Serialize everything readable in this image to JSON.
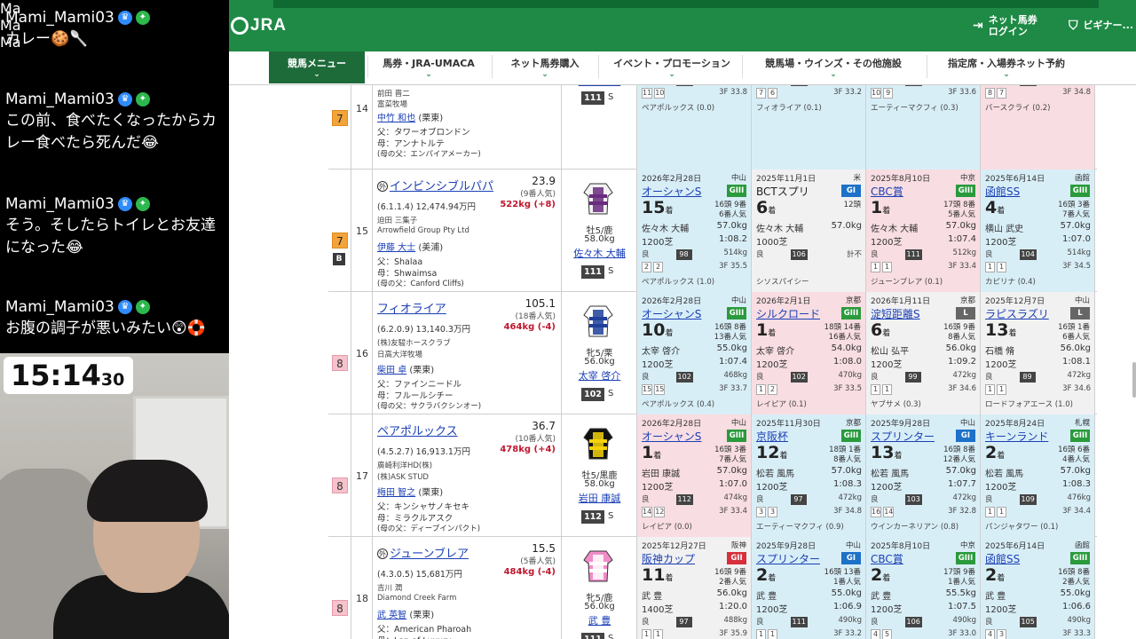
{
  "chat": {
    "messages": [
      {
        "user": "Mami_Mami03",
        "text": "カレー🍪🥄"
      },
      {
        "user": "Mami_Mami03",
        "text": "この前、食べたくなったからカレー食べたら死んだ😂"
      },
      {
        "user": "Mami_Mami03",
        "text": "そう。そしたらトイレとお友達になった😂"
      },
      {
        "user": "Mami_Mami03",
        "text": "お腹の調子が悪いみたい😲🛟"
      }
    ],
    "member_badge": "Ma"
  },
  "timer": {
    "main": "15:14",
    "sub": "30"
  },
  "header": {
    "logo": "JRA",
    "links": [
      "ネット馬券\nログイン",
      "ビギナー..."
    ],
    "nav": [
      "競馬メニュー",
      "馬券・JRA-UMACA",
      "ネット馬券購入",
      "イベント・プロモーション",
      "競馬場・ウインズ・その他施設",
      "指定席・入場券ネット予約"
    ]
  },
  "rows": [
    {
      "waku": "7",
      "num": "14",
      "partial": true,
      "owner": "前田 晋二",
      "breeder": "富菜牧場",
      "trainer": "中竹 和也",
      "region": "(栗東)",
      "sire": "父：タワーオブロンドン",
      "dam": "母：アンナトルテ",
      "damsire": "(母の父：エンパイアメーカー)",
      "sex": "牡4/鹿",
      "weight_carry": "58.0kg",
      "jockey": "丸山 元気",
      "rating": "111",
      "rating_s": "S",
      "past": [
        {
          "bg": "blue",
          "jockey": "戸崎 圭太",
          "kg": "57.0kg",
          "dist": "1200芝",
          "time": "1:07.0",
          "cond": "良",
          "score": "111",
          "bw": "510kg",
          "pos": [
            "11",
            "10"
          ],
          "last": "3F 33.8",
          "winner": "ペアポルックス (0.0)"
        },
        {
          "bg": "blue",
          "jockey": "佐々木 大輔",
          "kg": "57.0kg",
          "dist": "1200芝",
          "time": "1:08.1",
          "cond": "良",
          "score": "106",
          "bw": "516kg",
          "pos": [
            "7",
            "6"
          ],
          "last": "3F 33.2",
          "winner": "フィオライア (0.1)"
        },
        {
          "bg": "blue",
          "jockey": "鮫島 克駿",
          "kg": "56.0kg",
          "dist": "1200芝",
          "time": "1:07.7",
          "cond": "良",
          "score": "106",
          "bw": "506kg",
          "pos": [
            "10",
            "9"
          ],
          "last": "3F 33.6",
          "winner": "エーティーマクフィ (0.3)"
        },
        {
          "bg": "pink",
          "jockey": "丸山 元気",
          "kg": "56.0kg",
          "dist": "1200芝",
          "time": "1:08.3",
          "cond": "良",
          "score": "106",
          "bw": "502kg",
          "pos": [
            "8",
            "7"
          ],
          "last": "3F 34.8",
          "winner": "バースクライ (0.2)"
        }
      ]
    },
    {
      "waku": "7",
      "num": "15",
      "blinker": "B",
      "name": "インビンシブルパパ",
      "maru": "外",
      "odds": "23.9",
      "pop": "(9番人気)",
      "record": "(6.1.1.4) 12,474.94万円",
      "weight": "522kg (+8)",
      "owner": "迫田 三集子",
      "breeder": "Arrowfield Group Pty Ltd",
      "trainer": "伊藤 大士",
      "region": "(美浦)",
      "sire": "父：Shalaa",
      "dam": "母：Shwaimsa",
      "damsire": "(母の父：Canford Cliffs)",
      "sex": "牡5/鹿",
      "weight_carry": "58.0kg",
      "jockey": "佐々木 大輔",
      "rating": "111",
      "rating_s": "S",
      "silks": [
        "#f2f2f2",
        "#6a2c7e"
      ],
      "past": [
        {
          "bg": "blue",
          "date": "2026年2月28日",
          "venue": "中山",
          "race": "オーシャンS",
          "grade": "GIII",
          "place": "15",
          "fields": [
            "16頭 9番",
            "6番人気"
          ],
          "jockey": "佐々木 大輔",
          "kg": "57.0kg",
          "dist": "1200芝",
          "time": "1:08.2",
          "cond": "良",
          "score": "98",
          "bw": "514kg",
          "pos": [
            "2",
            "2"
          ],
          "last": "3F 35.5",
          "winner": "ペアポルックス (1.0)"
        },
        {
          "bg": "gray",
          "date": "2025年11月1日",
          "venue": "米",
          "race": "BCTスプリ",
          "grade": "GI",
          "place": "6",
          "fields": [
            "12頭",
            ""
          ],
          "jockey": "佐々木 大輔",
          "kg": "57.0kg",
          "dist": "1000芝",
          "time": "",
          "cond": "良",
          "score": "106",
          "bw": "計不",
          "pos": [],
          "last": "",
          "winner": "シソスパイシー",
          "plain": true
        },
        {
          "bg": "pink",
          "date": "2025年8月10日",
          "venue": "中京",
          "race": "CBC賞",
          "grade": "GIII",
          "place": "1",
          "fields": [
            "17頭 8番",
            "5番人気"
          ],
          "jockey": "佐々木 大輔",
          "kg": "57.0kg",
          "dist": "1200芝",
          "time": "1:07.4",
          "cond": "良",
          "score": "111",
          "bw": "512kg",
          "pos": [
            "1",
            "1"
          ],
          "last": "3F 33.4",
          "winner": "ジューンブレア (0.1)"
        },
        {
          "bg": "blue",
          "date": "2025年6月14日",
          "venue": "函館",
          "race": "函館SS",
          "grade": "GIII",
          "place": "4",
          "fields": [
            "16頭 3番",
            "7番人気"
          ],
          "jockey": "横山 武史",
          "kg": "57.0kg",
          "dist": "1200芝",
          "time": "1:07.0",
          "cond": "良",
          "score": "104",
          "bw": "514kg",
          "pos": [
            "1",
            "1"
          ],
          "last": "3F 34.5",
          "winner": "カピリナ (0.4)"
        }
      ]
    },
    {
      "waku": "8",
      "num": "16",
      "name": "フィオライア",
      "odds": "105.1",
      "pop": "(18番人気)",
      "record": "(6.2.0.9) 13,140.3万円",
      "weight": "464kg (-4)",
      "owner": "(株)友駿ホースクラブ",
      "breeder": "日高大洋牧場",
      "trainer": "柴田 卓",
      "region": "(栗東)",
      "sire": "父：ファインニードル",
      "dam": "母：フルールシチー",
      "damsire": "(母の父：サクラバクシンオー)",
      "sex": "牝5/栗",
      "weight_carry": "56.0kg",
      "jockey": "太宰 啓介",
      "rating": "102",
      "rating_s": "S",
      "silks": [
        "#ffffff",
        "#1f3f9a"
      ],
      "past": [
        {
          "bg": "blue",
          "date": "2026年2月28日",
          "venue": "中山",
          "race": "オーシャンS",
          "grade": "GIII",
          "place": "10",
          "fields": [
            "16頭 8番",
            "13番人気"
          ],
          "jockey": "太宰 啓介",
          "kg": "55.0kg",
          "dist": "1200芝",
          "time": "1:07.4",
          "cond": "良",
          "score": "102",
          "bw": "468kg",
          "pos": [
            "15",
            "15"
          ],
          "last": "3F 33.7",
          "winner": "ペアポルックス (0.4)"
        },
        {
          "bg": "pink",
          "date": "2026年2月1日",
          "venue": "京都",
          "race": "シルクロード",
          "grade": "GIII",
          "place": "1",
          "fields": [
            "18頭 14番",
            "16番人気"
          ],
          "jockey": "太宰 啓介",
          "kg": "54.0kg",
          "dist": "1200芝",
          "time": "1:08.0",
          "cond": "良",
          "score": "102",
          "bw": "470kg",
          "pos": [
            "1",
            "2"
          ],
          "last": "3F 33.5",
          "winner": "レイピア (0.1)"
        },
        {
          "bg": "gray",
          "date": "2026年1月11日",
          "venue": "京都",
          "race": "淀短距離S",
          "grade": "L",
          "place": "6",
          "fields": [
            "16頭 9番",
            "8番人気"
          ],
          "jockey": "松山 弘平",
          "kg": "56.0kg",
          "dist": "1200芝",
          "time": "1:09.2",
          "cond": "良",
          "score": "99",
          "bw": "472kg",
          "pos": [
            "1",
            "1"
          ],
          "last": "3F 34.6",
          "winner": "ヤブサメ (0.3)"
        },
        {
          "bg": "gray",
          "date": "2025年12月7日",
          "venue": "中山",
          "race": "ラピスラズリ",
          "grade": "L",
          "place": "13",
          "fields": [
            "16頭 1番",
            "6番人気"
          ],
          "jockey": "石橋 脩",
          "kg": "56.0kg",
          "dist": "1200芝",
          "time": "1:08.1",
          "cond": "良",
          "score": "89",
          "bw": "472kg",
          "pos": [
            "1",
            "1"
          ],
          "last": "3F 34.6",
          "winner": "ロードフォアエース (1.0)"
        }
      ]
    },
    {
      "waku": "8",
      "num": "17",
      "name": "ペアポルックス",
      "odds": "36.7",
      "pop": "(10番人気)",
      "record": "(4.5.2.7) 16,913.1万円",
      "weight": "478kg (+4)",
      "owner": "廣崎利洋HD(株)",
      "breeder": "(株)ASK STUD",
      "trainer": "梅田 智之",
      "region": "(栗東)",
      "sire": "父：キンシャサノキセキ",
      "dam": "母：ミラクルアスク",
      "damsire": "(母の父：ディープインパクト)",
      "sex": "牡5/黒鹿",
      "weight_carry": "58.0kg",
      "jockey": "岩田 康誠",
      "rating": "112",
      "rating_s": "S",
      "silks": [
        "#111111",
        "#f5d20a"
      ],
      "past": [
        {
          "bg": "pink",
          "date": "2026年2月28日",
          "venue": "中山",
          "race": "オーシャンS",
          "grade": "GIII",
          "place": "1",
          "fields": [
            "16頭 3番",
            "7番人気"
          ],
          "jockey": "岩田 康誠",
          "kg": "57.0kg",
          "dist": "1200芝",
          "time": "1:07.0",
          "cond": "良",
          "score": "112",
          "bw": "474kg",
          "pos": [
            "14",
            "12"
          ],
          "last": "3F 33.4",
          "winner": "レイピア (0.0)"
        },
        {
          "bg": "blue",
          "date": "2025年11月30日",
          "venue": "京都",
          "race": "京阪杯",
          "grade": "GIII",
          "place": "12",
          "fields": [
            "18頭 1番",
            "8番人気"
          ],
          "jockey": "松若 風馬",
          "kg": "57.0kg",
          "dist": "1200芝",
          "time": "1:08.3",
          "cond": "良",
          "score": "97",
          "bw": "472kg",
          "pos": [
            "3",
            "3"
          ],
          "last": "3F 34.8",
          "winner": "エーティーマクフィ (0.9)"
        },
        {
          "bg": "blue",
          "date": "2025年9月28日",
          "venue": "中山",
          "race": "スプリンター",
          "grade": "GI",
          "place": "13",
          "fields": [
            "16頭 8番",
            "12番人気"
          ],
          "jockey": "松若 風馬",
          "kg": "57.0kg",
          "dist": "1200芝",
          "time": "1:07.7",
          "cond": "良",
          "score": "103",
          "bw": "472kg",
          "pos": [
            "16",
            "14"
          ],
          "last": "3F 32.8",
          "winner": "ウインカーネリアン (0.8)"
        },
        {
          "bg": "blue",
          "date": "2025年8月24日",
          "venue": "札幌",
          "race": "キーンランド",
          "grade": "GIII",
          "place": "2",
          "fields": [
            "16頭 6番",
            "4番人気"
          ],
          "jockey": "松若 風馬",
          "kg": "57.0kg",
          "dist": "1200芝",
          "time": "1:08.3",
          "cond": "良",
          "score": "109",
          "bw": "476kg",
          "pos": [
            "1",
            "1"
          ],
          "last": "3F 34.4",
          "winner": "パンジャタワー (0.1)"
        }
      ]
    },
    {
      "waku": "8",
      "num": "18",
      "name": "ジューンブレア",
      "maru": "外",
      "odds": "15.5",
      "pop": "(5番人気)",
      "record": "(4.3.0.5) 15,681万円",
      "weight": "484kg (-4)",
      "owner": "吉川 潤",
      "breeder": "Diamond Creek Farm",
      "trainer": "武 英智",
      "region": "(栗東)",
      "sire": "父：American Pharoah",
      "dam": "母：Lap of Luxury",
      "damsire": "(母の父：Galileo)",
      "sex": "牝5/鹿",
      "weight_carry": "56.0kg",
      "jockey": "武 豊",
      "rating": "111",
      "rating_s": "S",
      "silks": [
        "#f08cc8",
        "#ffffff"
      ],
      "past": [
        {
          "bg": "gray",
          "date": "2025年12月27日",
          "venue": "阪神",
          "race": "阪神カップ",
          "grade": "GII",
          "place": "11",
          "fields": [
            "16頭 9番",
            "2番人気"
          ],
          "jockey": "武 豊",
          "kg": "56.0kg",
          "dist": "1400芝",
          "time": "1:20.0",
          "cond": "良",
          "score": "97",
          "bw": "488kg",
          "pos": [
            "1",
            "1"
          ],
          "last": "3F 35.9",
          "winner": "ルガル (1.0)"
        },
        {
          "bg": "blue",
          "date": "2025年9月28日",
          "venue": "中山",
          "race": "スプリンター",
          "grade": "GI",
          "place": "2",
          "fields": [
            "16頭 13番",
            "1番人気"
          ],
          "jockey": "武 豊",
          "kg": "55.0kg",
          "dist": "1200芝",
          "time": "1:06.9",
          "cond": "良",
          "score": "111",
          "bw": "490kg",
          "pos": [
            "1",
            "1"
          ],
          "last": "3F 33.2",
          "winner": "ウインカーネリアン (0.2)"
        },
        {
          "bg": "blue",
          "date": "2025年8月10日",
          "venue": "中京",
          "race": "CBC賞",
          "grade": "GIII",
          "place": "2",
          "fields": [
            "17頭 9番",
            "1番人気"
          ],
          "jockey": "武 豊",
          "kg": "55.5kg",
          "dist": "1200芝",
          "time": "1:07.5",
          "cond": "良",
          "score": "106",
          "bw": "490kg",
          "pos": [
            "4",
            "5"
          ],
          "last": "3F 33.0",
          "winner": "インビンシブルパパ (0.1)"
        },
        {
          "bg": "blue",
          "date": "2025年6月14日",
          "venue": "函館",
          "race": "函館SS",
          "grade": "GIII",
          "place": "2",
          "fields": [
            "16頭 8番",
            "2番人気"
          ],
          "jockey": "武 豊",
          "kg": "55.0kg",
          "dist": "1200芝",
          "time": "1:06.6",
          "cond": "良",
          "score": "105",
          "bw": "490kg",
          "pos": [
            "4",
            "3"
          ],
          "last": "3F 33.3",
          "winner": "カピリナ (0.1)"
        }
      ]
    }
  ]
}
